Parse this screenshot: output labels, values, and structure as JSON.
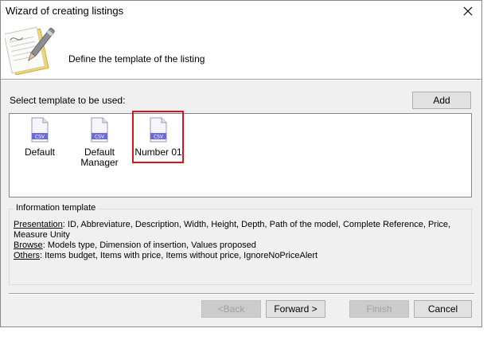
{
  "window": {
    "title": "Wizard of creating listings"
  },
  "header": {
    "text": "Define the template of the listing"
  },
  "select_label": "Select template to be used:",
  "buttons": {
    "add": "Add",
    "back": "<Back",
    "forward": "Forward >",
    "finish": "Finish",
    "cancel": "Cancel"
  },
  "templates": [
    {
      "label": "Default",
      "icon": "csv-file-icon"
    },
    {
      "label": "Default\nManager",
      "icon": "csv-file-icon"
    },
    {
      "label": "Number 01",
      "icon": "csv-file-icon",
      "selected": true
    }
  ],
  "file_icon_badge": "CSV",
  "info": {
    "legend": "Information template",
    "lines": [
      {
        "key": "Presentation",
        "sep": ": ",
        "value": "ID, Abbreviature, Description, Width, Height, Depth, Path of the model, Complete Reference, Price, Measure Unity"
      },
      {
        "key": "Browse",
        "sep": ": ",
        "value": "Models type, Dimension of insertion, Values proposed"
      },
      {
        "key": "Others",
        "sep": ": ",
        "value": "Items budget, Items with price, Items without price, IgnoreNoPriceAlert"
      }
    ]
  },
  "colors": {
    "highlight": "#d9141c",
    "csv_badge": "#6a6ad8"
  }
}
